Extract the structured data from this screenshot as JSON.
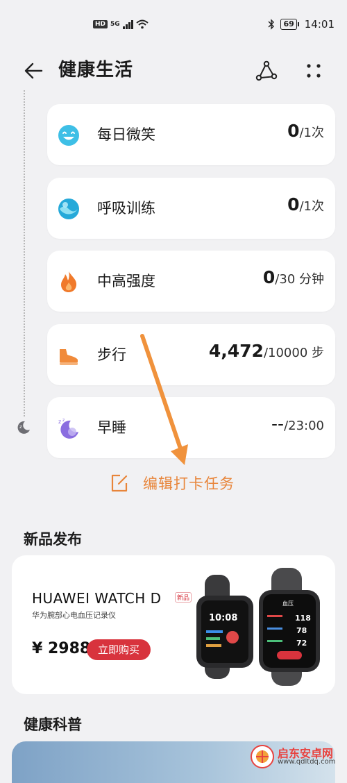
{
  "status_bar": {
    "left_badge": "HD",
    "network": "5G",
    "battery": "69",
    "time": "14:01"
  },
  "header": {
    "title": "健康生活",
    "back_icon": "arrow-left-icon",
    "share_icon": "share-icon",
    "more_icon": "more-dots-icon"
  },
  "tasks": [
    {
      "label": "每日微笑",
      "value": "0",
      "goal": "/1次",
      "icon": "smile-icon",
      "color": "#3ebfe6"
    },
    {
      "label": "呼吸训练",
      "value": "0",
      "goal": "/1次",
      "icon": "breath-icon",
      "color": "#25a9d9"
    },
    {
      "label": "中高强度",
      "value": "0",
      "goal": "/30 分钟",
      "icon": "flame-icon",
      "color": "#f07a2b"
    },
    {
      "label": "步行",
      "value": "4,472",
      "goal": "/10000 步",
      "icon": "shoe-icon",
      "color": "#f08a3a"
    },
    {
      "label": "早睡",
      "value": "--",
      "goal": "/23:00",
      "icon": "moon-icon",
      "color": "#8a6de0"
    }
  ],
  "edit": {
    "label": "编辑打卡任务",
    "icon": "edit-icon"
  },
  "new_products": {
    "title": "新品发布",
    "product_name": "HUAWEI WATCH D",
    "new_badge": "新品",
    "subtitle": "华为腕部心电血压记录仪",
    "price": "¥ 2988",
    "buy_label": "立即购买",
    "watch_screen": {
      "time": "10:08",
      "bp_title": "血压",
      "bp_high": "118",
      "bp_low": "78",
      "pulse": "72"
    }
  },
  "health_science": {
    "title": "健康科普"
  },
  "watermark": {
    "name": "启东安卓网",
    "url": "www.qdltdq.com"
  },
  "colors": {
    "accent_orange": "#e8853a",
    "buy_red": "#d8333d"
  }
}
